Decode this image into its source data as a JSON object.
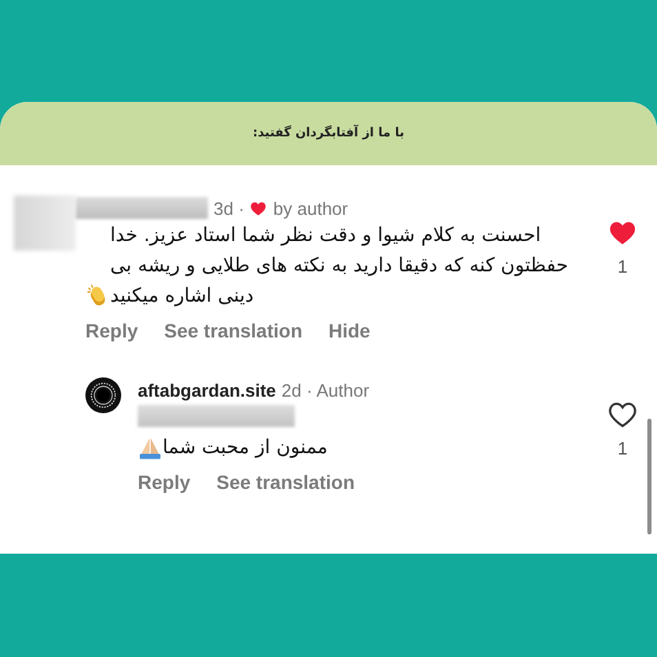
{
  "banner": {
    "text": "با ما از آفتابگردان گفتید:"
  },
  "comments": [
    {
      "kind": "comment",
      "meta": "3d ·",
      "author_heart": true,
      "badge": "by author",
      "text": "احسنت به کلام شیوا و دقت نظر شما استاد عزیز. خدا حفظتون کنه که دقیقا دارید به نکته های طلایی و ریشه بی دینی اشاره میکنید",
      "liked": true,
      "like_count": "1",
      "reply_label": "Reply",
      "translate_label": "See translation",
      "hide_label": "Hide"
    },
    {
      "kind": "reply",
      "username": "aftabgardan.site",
      "meta": "2d · Author",
      "author_heart": false,
      "text": "ممنون از محبت شما",
      "liked": false,
      "like_count": "1",
      "reply_label": "Reply",
      "translate_label": "See translation"
    }
  ]
}
